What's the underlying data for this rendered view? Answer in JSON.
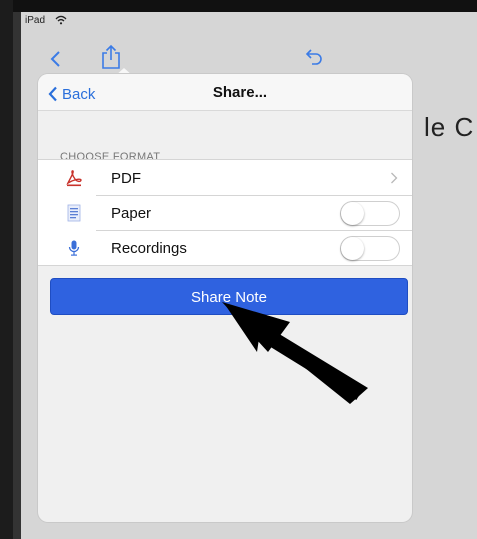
{
  "status_bar": {
    "device": "iPad"
  },
  "toolbar": {
    "icons": [
      "back-chevron-icon",
      "share-icon",
      "undo-icon"
    ]
  },
  "background": {
    "text_right": "le C"
  },
  "popover": {
    "back_label": "Back",
    "title": "Share...",
    "section_header": "CHOOSE FORMAT",
    "formats": [
      {
        "label": "PDF",
        "icon": "pdf-icon",
        "control": "chevron"
      },
      {
        "label": "Paper",
        "icon": "paper-icon",
        "control": "toggle",
        "on": false
      },
      {
        "label": "Recordings",
        "icon": "microphone-icon",
        "control": "toggle",
        "on": false
      }
    ],
    "share_button_label": "Share Note"
  },
  "colors": {
    "accent": "#2f62e0",
    "link": "#2a6fdb",
    "pdf_red": "#c8322b",
    "paper_blue": "#5b7fd4"
  }
}
